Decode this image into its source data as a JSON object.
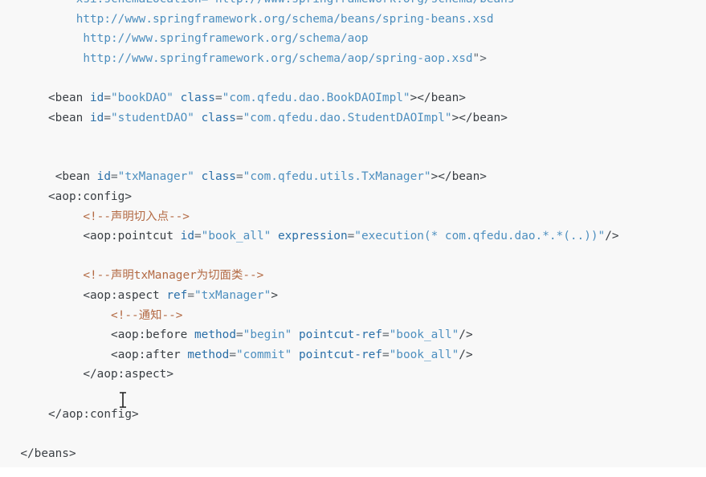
{
  "editor": {
    "lines": [
      {
        "indent": 10,
        "tokens": [
          {
            "t": "xsi:schemaLocation=\"http://www.springframework.org/schema/beans",
            "c": "text"
          }
        ]
      },
      {
        "indent": 10,
        "tokens": [
          {
            "t": "http://www.springframework.org/schema/beans/spring-beans.xsd",
            "c": "text"
          }
        ]
      },
      {
        "indent": 11,
        "tokens": [
          {
            "t": "http://www.springframework.org/schema/aop",
            "c": "text"
          }
        ]
      },
      {
        "indent": 11,
        "tokens": [
          {
            "t": "http://www.springframework.org/schema/aop/spring-aop.xsd",
            "c": "text"
          },
          {
            "t": "\">",
            "c": "punct"
          }
        ]
      },
      {
        "indent": 0,
        "tokens": []
      },
      {
        "indent": 6,
        "tokens": [
          {
            "t": "<bean ",
            "c": "tag"
          },
          {
            "t": "id",
            "c": "attr"
          },
          {
            "t": "=",
            "c": "punct"
          },
          {
            "t": "\"bookDAO\"",
            "c": "val"
          },
          {
            "t": " ",
            "c": "punct"
          },
          {
            "t": "class",
            "c": "attr"
          },
          {
            "t": "=",
            "c": "punct"
          },
          {
            "t": "\"com.qfedu.dao.BookDAOImpl\"",
            "c": "val"
          },
          {
            "t": "></bean>",
            "c": "tag"
          }
        ]
      },
      {
        "indent": 6,
        "tokens": [
          {
            "t": "<bean ",
            "c": "tag"
          },
          {
            "t": "id",
            "c": "attr"
          },
          {
            "t": "=",
            "c": "punct"
          },
          {
            "t": "\"studentDAO\"",
            "c": "val"
          },
          {
            "t": " ",
            "c": "punct"
          },
          {
            "t": "class",
            "c": "attr"
          },
          {
            "t": "=",
            "c": "punct"
          },
          {
            "t": "\"com.qfedu.dao.StudentDAOImpl\"",
            "c": "val"
          },
          {
            "t": "></bean>",
            "c": "tag"
          }
        ]
      },
      {
        "indent": 0,
        "tokens": []
      },
      {
        "indent": 0,
        "tokens": []
      },
      {
        "indent": 7,
        "tokens": [
          {
            "t": "<bean ",
            "c": "tag"
          },
          {
            "t": "id",
            "c": "attr"
          },
          {
            "t": "=",
            "c": "punct"
          },
          {
            "t": "\"txManager\"",
            "c": "val"
          },
          {
            "t": " ",
            "c": "punct"
          },
          {
            "t": "class",
            "c": "attr"
          },
          {
            "t": "=",
            "c": "punct"
          },
          {
            "t": "\"com.qfedu.utils.TxManager\"",
            "c": "val"
          },
          {
            "t": "></bean>",
            "c": "tag"
          }
        ]
      },
      {
        "indent": 6,
        "tokens": [
          {
            "t": "<aop:config>",
            "c": "tag"
          }
        ]
      },
      {
        "indent": 11,
        "tokens": [
          {
            "t": "<!--声明切入点-->",
            "c": "comment"
          }
        ]
      },
      {
        "indent": 11,
        "tokens": [
          {
            "t": "<aop:pointcut ",
            "c": "tag"
          },
          {
            "t": "id",
            "c": "attr"
          },
          {
            "t": "=",
            "c": "punct"
          },
          {
            "t": "\"book_all\"",
            "c": "val"
          },
          {
            "t": " ",
            "c": "punct"
          },
          {
            "t": "expression",
            "c": "attr"
          },
          {
            "t": "=",
            "c": "punct"
          },
          {
            "t": "\"execution(* com.qfedu.dao.*.*(..))\"",
            "c": "val"
          },
          {
            "t": "/>",
            "c": "tag"
          }
        ]
      },
      {
        "indent": 0,
        "tokens": []
      },
      {
        "indent": 11,
        "tokens": [
          {
            "t": "<!--声明txManager为切面类-->",
            "c": "comment"
          }
        ]
      },
      {
        "indent": 11,
        "tokens": [
          {
            "t": "<aop:aspect ",
            "c": "tag"
          },
          {
            "t": "ref",
            "c": "attr"
          },
          {
            "t": "=",
            "c": "punct"
          },
          {
            "t": "\"txManager\"",
            "c": "val"
          },
          {
            "t": ">",
            "c": "tag"
          }
        ]
      },
      {
        "indent": 15,
        "tokens": [
          {
            "t": "<!--通知-->",
            "c": "comment"
          }
        ]
      },
      {
        "indent": 15,
        "tokens": [
          {
            "t": "<aop:before ",
            "c": "tag"
          },
          {
            "t": "method",
            "c": "attr"
          },
          {
            "t": "=",
            "c": "punct"
          },
          {
            "t": "\"begin\"",
            "c": "val"
          },
          {
            "t": " ",
            "c": "punct"
          },
          {
            "t": "pointcut-ref",
            "c": "attr"
          },
          {
            "t": "=",
            "c": "punct"
          },
          {
            "t": "\"book_all\"",
            "c": "val"
          },
          {
            "t": "/>",
            "c": "tag"
          }
        ]
      },
      {
        "indent": 15,
        "tokens": [
          {
            "t": "<aop:after ",
            "c": "tag"
          },
          {
            "t": "method",
            "c": "attr"
          },
          {
            "t": "=",
            "c": "punct"
          },
          {
            "t": "\"commit\"",
            "c": "val"
          },
          {
            "t": " ",
            "c": "punct"
          },
          {
            "t": "pointcut-ref",
            "c": "attr"
          },
          {
            "t": "=",
            "c": "punct"
          },
          {
            "t": "\"book_all\"",
            "c": "val"
          },
          {
            "t": "/>",
            "c": "tag"
          }
        ]
      },
      {
        "indent": 11,
        "tokens": [
          {
            "t": "</aop:aspect>",
            "c": "tag"
          }
        ]
      },
      {
        "indent": 0,
        "tokens": []
      },
      {
        "indent": 6,
        "tokens": [
          {
            "t": "</aop:config>",
            "c": "tag"
          }
        ]
      },
      {
        "indent": 0,
        "tokens": []
      },
      {
        "indent": 2,
        "tokens": [
          {
            "t": "</beans>",
            "c": "tag"
          }
        ]
      }
    ]
  },
  "colors": {
    "tag": "#3a3f44",
    "attr": "#2a6fa8",
    "value": "#4d8fbf",
    "comment": "#b36a44",
    "background": "#f8f8f8"
  },
  "icons": {
    "cursor": "i-beam-cursor-icon"
  }
}
